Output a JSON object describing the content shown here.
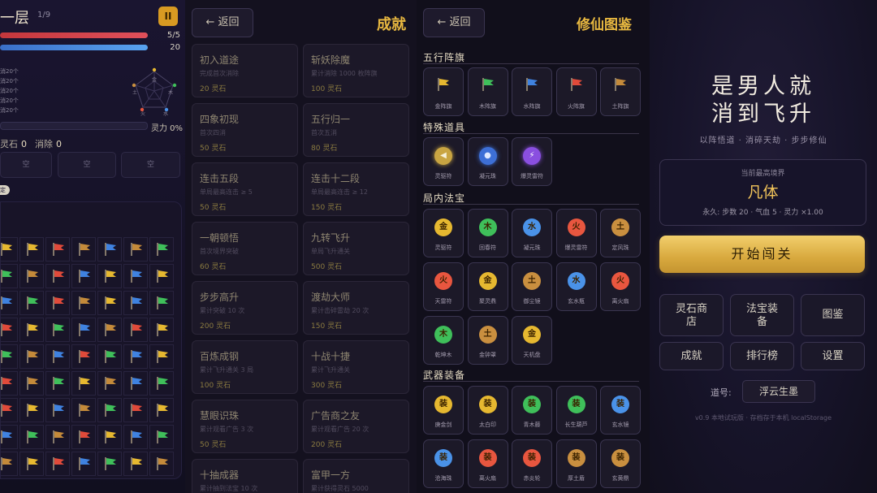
{
  "game": {
    "level_title": "一层",
    "level_count": "1/9",
    "pause_glyph": "II",
    "hp_value": "5/5",
    "mp_value": "20",
    "stat_lines": [
      "消20个",
      "消20个",
      "消20个",
      "消20个",
      "消20个"
    ],
    "radar_labels": [
      "金",
      "木",
      "土",
      "水",
      "火"
    ],
    "spirit_label": "灵力 0%",
    "stones_label": "灵石",
    "stones_value": "0",
    "clear_label": "消除",
    "clear_value": "0",
    "slots": [
      "空",
      "空",
      "空"
    ],
    "lock_glyph": "定"
  },
  "achievements": {
    "back_label": "← 返回",
    "title": "成就",
    "items": [
      {
        "name": "初入道途",
        "desc": "完成首次消除",
        "reward": "20 灵石"
      },
      {
        "name": "斩妖除魔",
        "desc": "累计消除 1000 枚阵旗",
        "reward": "100 灵石"
      },
      {
        "name": "四象初现",
        "desc": "首次四消",
        "reward": "50 灵石"
      },
      {
        "name": "五行归一",
        "desc": "首次五消",
        "reward": "80 灵石"
      },
      {
        "name": "连击五段",
        "desc": "单局最高连击 ≥ 5",
        "reward": "50 灵石"
      },
      {
        "name": "连击十二段",
        "desc": "单局最高连击 ≥ 12",
        "reward": "150 灵石"
      },
      {
        "name": "一朝顿悟",
        "desc": "首次境界突破",
        "reward": "60 灵石"
      },
      {
        "name": "九转飞升",
        "desc": "单局飞升通关",
        "reward": "500 灵石"
      },
      {
        "name": "步步高升",
        "desc": "累计突破 10 次",
        "reward": "200 灵石"
      },
      {
        "name": "渡劫大师",
        "desc": "累计击碎雷劫 20 次",
        "reward": "150 灵石"
      },
      {
        "name": "百炼成钢",
        "desc": "累计飞升通关 3 局",
        "reward": "100 灵石"
      },
      {
        "name": "十战十捷",
        "desc": "累计飞升通关",
        "reward": "300 灵石"
      },
      {
        "name": "慧眼识珠",
        "desc": "累计观看广告 3 次",
        "reward": "50 灵石"
      },
      {
        "name": "广告商之友",
        "desc": "累计观看广告 20 次",
        "reward": "200 灵石"
      },
      {
        "name": "十抽成器",
        "desc": "累计抽到法宝 10 次",
        "reward": ""
      },
      {
        "name": "富甲一方",
        "desc": "累计获得灵石 5000",
        "reward": ""
      }
    ]
  },
  "codex": {
    "back_label": "← 返回",
    "title": "修仙图鉴",
    "sec_flags": "五行阵旗",
    "flags": [
      {
        "label": "金阵旗",
        "color": "#e6b830"
      },
      {
        "label": "木阵旗",
        "color": "#3fbf5a"
      },
      {
        "label": "水阵旗",
        "color": "#3f82e0"
      },
      {
        "label": "火阵旗",
        "color": "#e04a3a"
      },
      {
        "label": "土阵旗",
        "color": "#c48a3a"
      }
    ],
    "sec_special": "特殊道具",
    "special": [
      {
        "label": "灵驱符",
        "glyph": "◀",
        "bg": "#c9a542",
        "fg": "#f6f0d8"
      },
      {
        "label": "凝元珠",
        "glyph": "●",
        "bg": "#3d6fd6",
        "fg": "#dfe9ff"
      },
      {
        "label": "爆灵雷符",
        "glyph": "⚡",
        "bg": "#8a4fe0",
        "fg": "#ffffff"
      }
    ],
    "sec_treasure": "局内法宝",
    "treasures": [
      {
        "label": "灵驱符",
        "glyph": "金",
        "bg": "#e6b830"
      },
      {
        "label": "回春符",
        "glyph": "木",
        "bg": "#3fbf5a"
      },
      {
        "label": "凝元珠",
        "glyph": "水",
        "bg": "#4a92e8"
      },
      {
        "label": "爆灵雷符",
        "glyph": "火",
        "bg": "#e8563f"
      },
      {
        "label": "定风珠",
        "glyph": "土",
        "bg": "#c98f3f"
      },
      {
        "label": "天雷符",
        "glyph": "火",
        "bg": "#e8563f"
      },
      {
        "label": "聚灵鼎",
        "glyph": "金",
        "bg": "#e6b830"
      },
      {
        "label": "御尘镜",
        "glyph": "土",
        "bg": "#c98f3f"
      },
      {
        "label": "玄水瓶",
        "glyph": "水",
        "bg": "#4a92e8"
      },
      {
        "label": "离火扇",
        "glyph": "火",
        "bg": "#e8563f"
      },
      {
        "label": "乾坤木",
        "glyph": "木",
        "bg": "#3fbf5a"
      },
      {
        "label": "金钟罩",
        "glyph": "土",
        "bg": "#c98f3f"
      },
      {
        "label": "天机盘",
        "glyph": "金",
        "bg": "#e6b830"
      }
    ],
    "sec_weapons": "武器装备",
    "weapons": [
      {
        "label": "庚金剑",
        "glyph": "装",
        "bg": "#e6b830"
      },
      {
        "label": "太白印",
        "glyph": "装",
        "bg": "#e6b830"
      },
      {
        "label": "青木藤",
        "glyph": "装",
        "bg": "#3fbf5a"
      },
      {
        "label": "长生葫芦",
        "glyph": "装",
        "bg": "#3fbf5a"
      },
      {
        "label": "玄水镜",
        "glyph": "装",
        "bg": "#4a92e8"
      },
      {
        "label": "沧海珠",
        "glyph": "装",
        "bg": "#4a92e8"
      },
      {
        "label": "离火扇",
        "glyph": "装",
        "bg": "#e8563f"
      },
      {
        "label": "赤炎轮",
        "glyph": "装",
        "bg": "#e8563f"
      },
      {
        "label": "厚土盾",
        "glyph": "装",
        "bg": "#c98f3f"
      },
      {
        "label": "玄黄鼎",
        "glyph": "装",
        "bg": "#c98f3f"
      }
    ]
  },
  "home": {
    "title_line1": "是男人就",
    "title_line2": "消到飞升",
    "subtitle": "以阵悟道 · 消碎天劫 · 步步修仙",
    "realm_label": "当前最高境界",
    "realm_name": "凡体",
    "realm_perm": "永久: 步数 20 · 气血 5 · 灵力 ×1.00",
    "start_label": "开始闯关",
    "menu": [
      "灵石商店",
      "法宝装备",
      "图鉴",
      "成就",
      "排行榜",
      "设置"
    ],
    "dao_label": "道号:",
    "dao_name": "浮云生墨",
    "footer": "v0.9 本地试玩版 · 存档存于本机 localStorage"
  }
}
